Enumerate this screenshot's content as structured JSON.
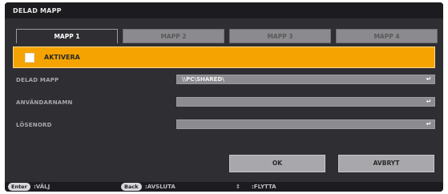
{
  "window": {
    "title": "DELAD MAPP"
  },
  "tabs": [
    {
      "label": "MAPP 1",
      "active": true
    },
    {
      "label": "MAPP 2",
      "active": false
    },
    {
      "label": "MAPP 3",
      "active": false
    },
    {
      "label": "MAPP 4",
      "active": false
    }
  ],
  "activate": {
    "label": "AKTIVERA",
    "checked": false
  },
  "fields": {
    "shared_folder": {
      "label": "DELAD MAPP",
      "value": "\\\\PC\\SHARED\\"
    },
    "username": {
      "label": "ANVÄNDARNAMN",
      "value": ""
    },
    "password": {
      "label": "LÖSENORD",
      "value": ""
    }
  },
  "buttons": {
    "ok": "OK",
    "cancel": "AVBRYT"
  },
  "footer": {
    "enter_key": "Enter",
    "enter_action": ":VÄLJ",
    "back_key": "Back",
    "back_action": ":AVSLUTA",
    "move_symbol": "↕",
    "move_action": ":FLYTTA"
  },
  "icons": {
    "field_enter": "enter-arrow-icon",
    "checkbox": "checkbox-icon"
  },
  "colors": {
    "accent": "#f5a300",
    "background": "#2e2e33",
    "field": "#8c8c90"
  }
}
